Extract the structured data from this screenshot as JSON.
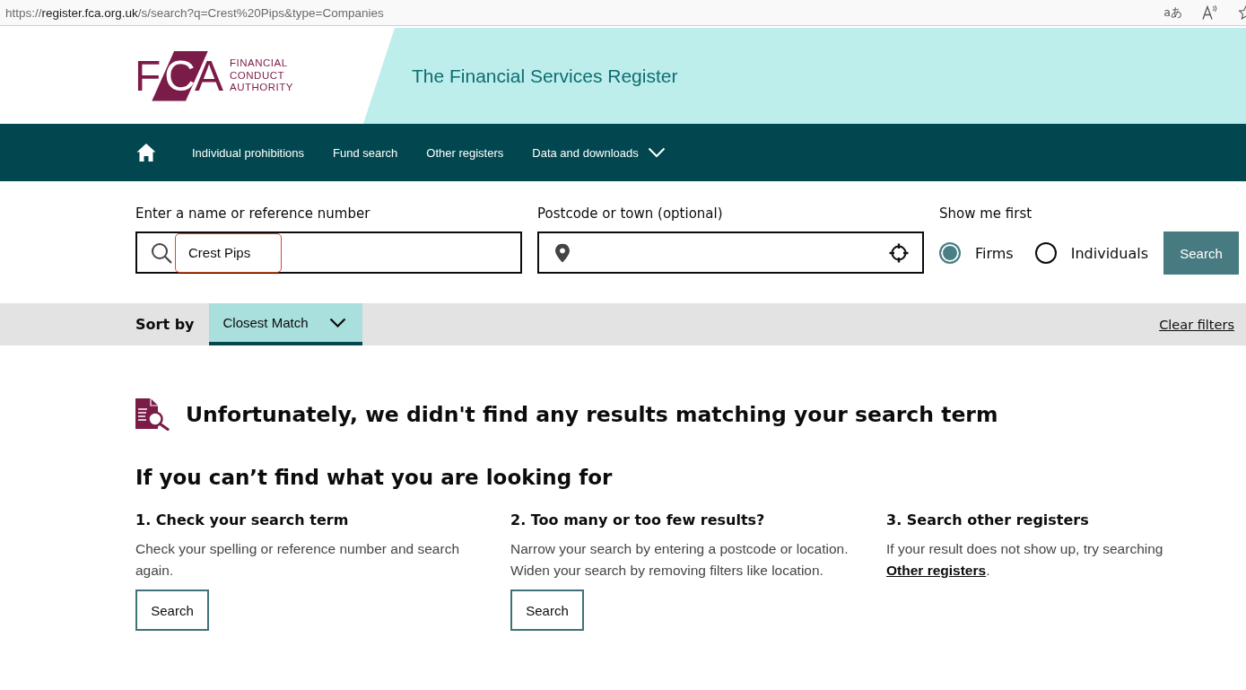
{
  "browser": {
    "url": {
      "scheme": "https://",
      "host": "register.fca.org.uk",
      "path": "/s/search?q=Crest%20Pips&type=Companies"
    },
    "translate_icon": "aあ"
  },
  "header": {
    "logo": {
      "letters": [
        {
          "char": "F",
          "boxed": false
        },
        {
          "char": "C",
          "boxed": true
        },
        {
          "char": "A",
          "boxed": false
        }
      ],
      "name_lines": [
        "FINANCIAL",
        "CONDUCT",
        "AUTHORITY"
      ]
    },
    "title": "The Financial Services Register"
  },
  "nav": {
    "items": [
      {
        "label": "Individual prohibitions",
        "kind": "link"
      },
      {
        "label": "Fund search",
        "kind": "link"
      },
      {
        "label": "Other registers",
        "kind": "link"
      },
      {
        "label": "Data and downloads",
        "kind": "dropdown"
      }
    ]
  },
  "search": {
    "name_field": {
      "label": "Enter a name or reference number",
      "value": "Crest Pips",
      "annotated": true
    },
    "location_field": {
      "label": "Postcode or town (optional)"
    },
    "show_first": {
      "label": "Show me first",
      "options": [
        {
          "label": "Firms",
          "selected": true
        },
        {
          "label": "Individuals",
          "selected": false
        }
      ]
    },
    "button": "Search"
  },
  "sort": {
    "label": "Sort by",
    "value": "Closest Match",
    "clear": "Clear filters"
  },
  "message": {
    "heading": "Unfortunately, we didn't find any results matching your search term"
  },
  "help": {
    "title": "If you can’t find what you are looking for",
    "columns": [
      {
        "heading": "1. Check your search term",
        "body": "Check your spelling or reference number and search again.",
        "button": "Search"
      },
      {
        "heading": "2. Too many or too few results?",
        "body": "Narrow your search by entering a postcode or location. Widen your search by removing filters like location.",
        "button": "Search"
      },
      {
        "heading": "3. Search other registers",
        "body": "If your result does not show up, try searching",
        "link": "Other registers",
        "after": "."
      }
    ]
  }
}
